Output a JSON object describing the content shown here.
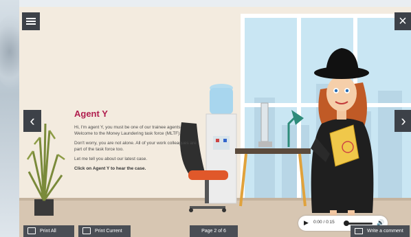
{
  "course": {
    "title": "Agent Y",
    "paragraphs": [
      "Hi, I'm agent Y, you must be one of our trainee agents. Welcome to the Money Laundering task force (MLTF).",
      "Don't worry, you are not alone. All of your work colleagues are part of the task force too.",
      "Let me tell you about our latest case."
    ],
    "instruction": "Click on Agent Y to hear the case."
  },
  "controls": {
    "print_all": "Print All",
    "print_current": "Print Current",
    "page_indicator": "Page 2 of 6",
    "write_comment": "Write a comment",
    "close": "×",
    "prev": "‹",
    "next": "›"
  },
  "audio": {
    "time": "0:00 / 0:15",
    "play_icon": "play-icon",
    "volume_icon": "volume-icon"
  },
  "colors": {
    "title": "#b01e4e",
    "bar": "#4a4e55",
    "agent_coat": "#1f1f1f",
    "hat": "#111111",
    "hair": "#c05a26"
  }
}
